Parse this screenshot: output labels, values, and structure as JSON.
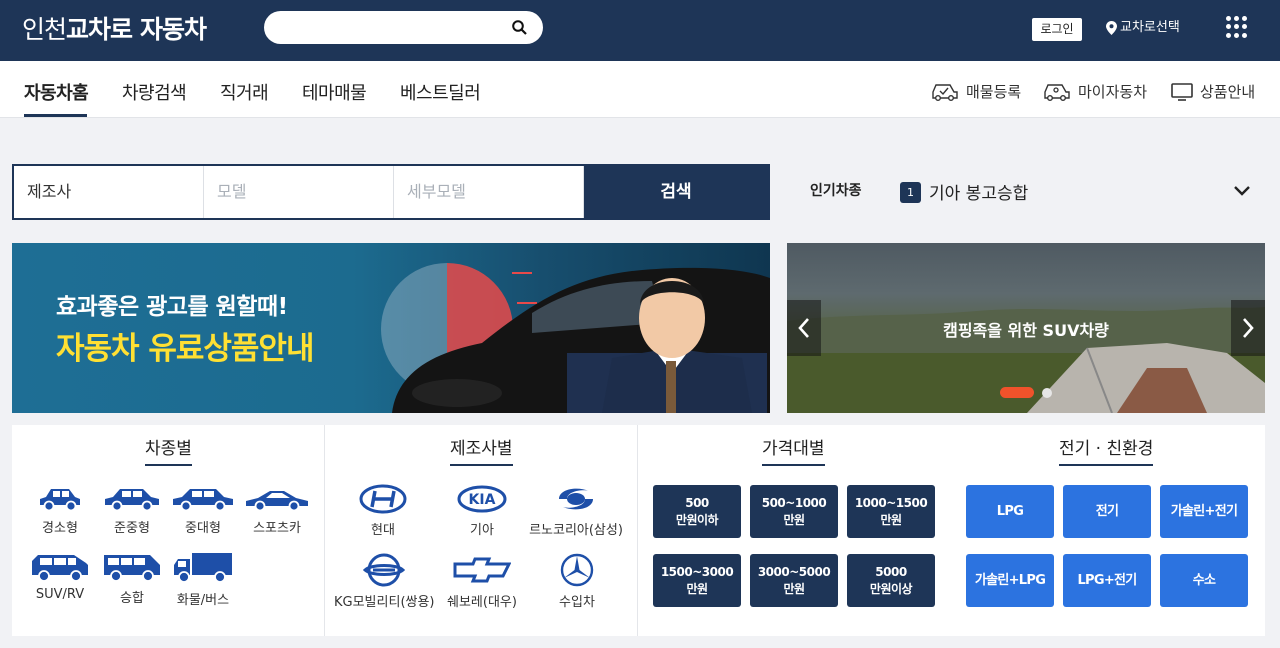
{
  "header": {
    "logo_region": "인천",
    "logo_name": "교차로",
    "logo_suffix": "자동차",
    "login_label": "로그인",
    "region_label": "교차로선택",
    "search_placeholder": ""
  },
  "nav": {
    "tabs": [
      {
        "label": "자동차홈",
        "active": true
      },
      {
        "label": "차량검색"
      },
      {
        "label": "직거래"
      },
      {
        "label": "테마매물"
      },
      {
        "label": "베스트딜러"
      }
    ],
    "utilities": [
      {
        "label": "매물등록",
        "icon": "car-check-icon"
      },
      {
        "label": "마이자동차",
        "icon": "my-car-icon"
      },
      {
        "label": "상품안내",
        "icon": "monitor-icon"
      }
    ]
  },
  "search_form": {
    "maker": "제조사",
    "model_placeholder": "모델",
    "submodel_placeholder": "세부모델",
    "button": "검색"
  },
  "popular": {
    "label": "인기차종",
    "rank": "1",
    "car": "기아 봉고승합"
  },
  "banner_ad": {
    "line1": "효과좋은 광고를 원할때!",
    "line2": "자동차 유료상품안내"
  },
  "banner_slide": {
    "caption": "캠핑족을 위한 SUV차량",
    "slides": 2,
    "active_slide": 1
  },
  "categories": {
    "by_type": {
      "title": "차종별",
      "items": [
        "경소형",
        "준중형",
        "중대형",
        "스포츠카",
        "SUV/RV",
        "승합",
        "화물/버스"
      ]
    },
    "by_maker": {
      "title": "제조사별",
      "items": [
        "현대",
        "기아",
        "르노코리아(삼성)",
        "KG모빌리티(쌍용)",
        "쉐보레(대우)",
        "수입차"
      ]
    },
    "by_price": {
      "title": "가격대별",
      "items": [
        {
          "top": "500",
          "bottom": "만원이하"
        },
        {
          "top": "500~1000",
          "bottom": "만원"
        },
        {
          "top": "1000~1500",
          "bottom": "만원"
        },
        {
          "top": "1500~3000",
          "bottom": "만원"
        },
        {
          "top": "3000~5000",
          "bottom": "만원"
        },
        {
          "top": "5000",
          "bottom": "만원이상"
        }
      ]
    },
    "by_fuel": {
      "title": "전기 · 친환경",
      "items": [
        "LPG",
        "전기",
        "가솔린+전기",
        "가솔린+LPG",
        "LPG+전기",
        "수소"
      ]
    }
  },
  "colors": {
    "navy": "#1e3557",
    "blue_button": "#2c73e0",
    "banner_yellow": "#ffe033",
    "slider_dot_active": "#f0522b"
  }
}
